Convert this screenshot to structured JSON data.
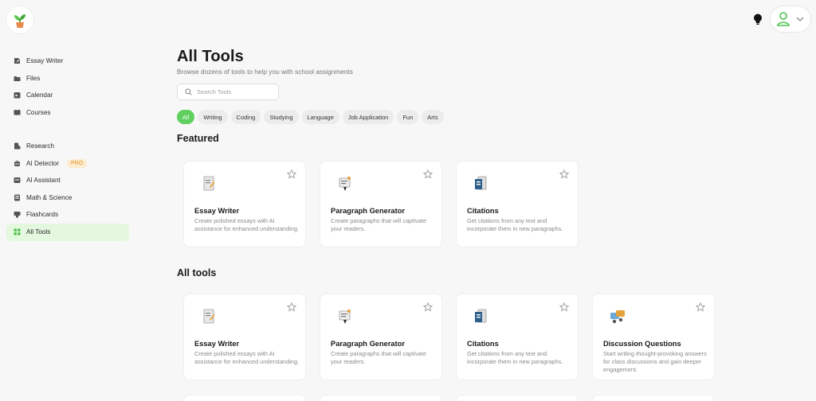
{
  "sidebar": {
    "group1": [
      {
        "label": "Essay Writer",
        "icon": "essay-icon"
      },
      {
        "label": "Files",
        "icon": "folder-icon"
      },
      {
        "label": "Calendar",
        "icon": "calendar-icon"
      },
      {
        "label": "Courses",
        "icon": "book-icon"
      }
    ],
    "group2": [
      {
        "label": "Research",
        "icon": "research-icon"
      },
      {
        "label": "AI Detector",
        "icon": "detector-icon",
        "badge": "PRO"
      },
      {
        "label": "AI Assistant",
        "icon": "assistant-icon"
      },
      {
        "label": "Math & Science",
        "icon": "math-icon"
      },
      {
        "label": "Flashcards",
        "icon": "flashcards-icon"
      },
      {
        "label": "All Tools",
        "icon": "grid-icon",
        "active": true
      }
    ]
  },
  "header": {
    "title": "All Tools",
    "subtitle": "Browse dozens of tools to help you with school assignments"
  },
  "search": {
    "placeholder": "Search Tools",
    "value": ""
  },
  "filters": [
    "All",
    "Writing",
    "Coding",
    "Studying",
    "Language",
    "Job Application",
    "Fun",
    "Arts"
  ],
  "featured": {
    "title": "Featured",
    "cards": [
      {
        "name": "Essay Writer",
        "desc": "Create polished essays with AI assistance for enhanced understanding."
      },
      {
        "name": "Paragraph Generator",
        "desc": "Create paragraphs that will captivate your readers."
      },
      {
        "name": "Citations",
        "desc": "Get citations from any text and incorporate them in new paragraphs."
      }
    ]
  },
  "all_tools": {
    "title": "All tools",
    "cards": [
      {
        "name": "Essay Writer",
        "desc": "Create polished essays with AI assistance for enhanced understanding."
      },
      {
        "name": "Paragraph Generator",
        "desc": "Create paragraphs that will captivate your readers."
      },
      {
        "name": "Citations",
        "desc": "Get citations from any text and incorporate them in new paragraphs."
      },
      {
        "name": "Discussion Questions",
        "desc": "Start writing thought-provoking answers for class discussions and gain deeper engagement."
      }
    ]
  },
  "colors": {
    "accent": "#5fcf5f",
    "active_bg": "#e4f7df",
    "pro_bg": "#fdeccf",
    "pro_text": "#e0912a"
  }
}
